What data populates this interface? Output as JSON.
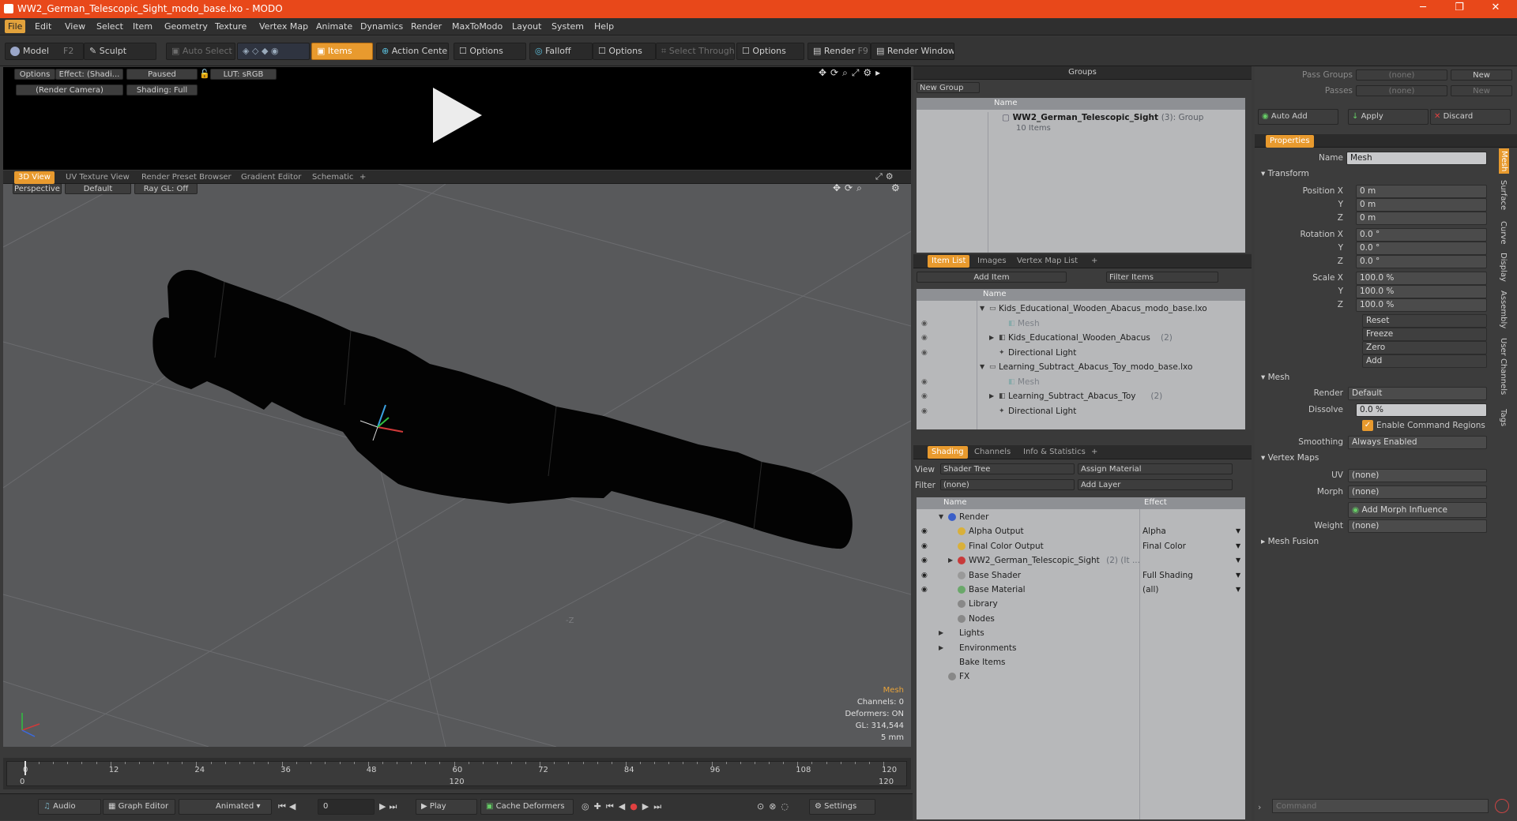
{
  "window": {
    "title": "WW2_German_Telescopic_Sight_modo_base.lxo - MODO",
    "min": "─",
    "max": "❐",
    "close": "✕"
  },
  "menu": [
    "File",
    "Edit",
    "View",
    "Select",
    "Item",
    "Geometry",
    "Texture",
    "Vertex Map",
    "Animate",
    "Dynamics",
    "Render",
    "MaxToModo",
    "Layout",
    "System",
    "Help"
  ],
  "toolbar": {
    "model": "Model",
    "model_key": "F2",
    "sculpt": "Sculpt",
    "auto_select": "Auto Select",
    "items": "Items",
    "action_center": "Action Center",
    "options1": "Options",
    "falloff": "Falloff",
    "options2": "Options",
    "select_through": "Select Through",
    "options3": "Options",
    "render": "Render",
    "render_key": "F9",
    "render_window": "Render Window"
  },
  "preview": {
    "options": "Options",
    "effect": "Effect: (Shadi...",
    "paused": "Paused",
    "lut": "LUT: sRGB",
    "camera": "(Render Camera)",
    "shading": "Shading: Full"
  },
  "viewtabs": [
    "3D View",
    "UV Texture View",
    "Render Preset Browser",
    "Gradient Editor",
    "Schematic",
    "+"
  ],
  "viewport": {
    "perspective": "Perspective",
    "default": "Default",
    "raygl": "Ray GL: Off",
    "hud_title": "Mesh",
    "hud_lines": [
      "Channels: 0",
      "Deformers: ON",
      "GL: 314,544",
      "5 mm"
    ],
    "axis_label": "-Z"
  },
  "timeline": {
    "ticks": [
      "0",
      "12",
      "24",
      "36",
      "48",
      "60",
      "72",
      "84",
      "96",
      "108",
      "120"
    ],
    "bottom_ticks": [
      "0",
      "120",
      "120"
    ]
  },
  "bottombar": {
    "audio": "Audio",
    "graph_editor": "Graph Editor",
    "animated": "Animated",
    "frame": "0",
    "play": "Play",
    "cache": "Cache Deformers",
    "settings": "Settings"
  },
  "groups": {
    "title": "Groups",
    "new_group": "New Group",
    "col_name": "Name",
    "item_name": "WW2_German_Telescopic_Sight",
    "item_count": "(3)",
    "item_type": ": Group",
    "item_sub": "10 Items"
  },
  "itemlist": {
    "tabs": [
      "Item List",
      "Images",
      "Vertex Map List",
      "+"
    ],
    "add_item": "Add Item",
    "filter": "Filter Items",
    "col_name": "Name",
    "rows": [
      {
        "t": "Kids_Educational_Wooden_Abacus_modo_base.lxo",
        "ind": 0,
        "dim": false,
        "exp": "▼",
        "eye": false
      },
      {
        "t": "Mesh",
        "ind": 2,
        "dim": true,
        "exp": "",
        "eye": true
      },
      {
        "t": "Kids_Educational_Wooden_Abacus",
        "extra": "(2)",
        "ind": 1,
        "dim": false,
        "exp": "▶",
        "eye": true
      },
      {
        "t": "Directional Light",
        "ind": 1,
        "dim": false,
        "exp": "",
        "eye": true
      },
      {
        "t": "Learning_Subtract_Abacus_Toy_modo_base.lxo",
        "ind": 0,
        "dim": false,
        "exp": "▼",
        "eye": false
      },
      {
        "t": "Mesh",
        "ind": 2,
        "dim": true,
        "exp": "",
        "eye": true
      },
      {
        "t": "Learning_Subtract_Abacus_Toy",
        "extra": "(2)",
        "ind": 1,
        "dim": false,
        "exp": "▶",
        "eye": true
      },
      {
        "t": "Directional Light",
        "ind": 1,
        "dim": false,
        "exp": "",
        "eye": true
      }
    ]
  },
  "shading": {
    "tabs": [
      "Shading",
      "Channels",
      "Info & Statistics",
      "+"
    ],
    "view_label": "View",
    "view_val": "Shader Tree",
    "assign": "Assign Material",
    "filter_label": "Filter",
    "filter_val": "(none)",
    "add_layer": "Add Layer",
    "col_name": "Name",
    "col_effect": "Effect",
    "rows": [
      {
        "t": "Render",
        "effect": "",
        "ind": 0,
        "exp": "▼",
        "eye": false,
        "icon": "#3b5fc8"
      },
      {
        "t": "Alpha Output",
        "effect": "Alpha",
        "ind": 1,
        "exp": "",
        "eye": true,
        "icon": "#d9b03a"
      },
      {
        "t": "Final Color Output",
        "effect": "Final Color",
        "ind": 1,
        "exp": "",
        "eye": true,
        "icon": "#d9b03a"
      },
      {
        "t": "WW2_German_Telescopic_Sight",
        "extra": "(2) (It ...",
        "effect": "",
        "ind": 1,
        "exp": "▶",
        "eye": true,
        "icon": "#c83a3a"
      },
      {
        "t": "Base Shader",
        "effect": "Full Shading",
        "ind": 1,
        "exp": "",
        "eye": true,
        "icon": "#999999"
      },
      {
        "t": "Base Material",
        "effect": "(all)",
        "ind": 1,
        "exp": "",
        "eye": true,
        "icon": "#6aa86a"
      },
      {
        "t": "Library",
        "effect": "",
        "ind": 1,
        "exp": "",
        "eye": false,
        "icon": "#888888"
      },
      {
        "t": "Nodes",
        "effect": "",
        "ind": 1,
        "exp": "",
        "eye": false,
        "icon": "#888888"
      },
      {
        "t": "Lights",
        "effect": "",
        "ind": 0,
        "exp": "▶",
        "eye": false,
        "icon": ""
      },
      {
        "t": "Environments",
        "effect": "",
        "ind": 0,
        "exp": "▶",
        "eye": false,
        "icon": ""
      },
      {
        "t": "Bake Items",
        "effect": "",
        "ind": 0,
        "exp": "",
        "eye": false,
        "icon": ""
      },
      {
        "t": "FX",
        "effect": "",
        "ind": 0,
        "exp": "",
        "eye": false,
        "icon": "#888888"
      }
    ]
  },
  "passes": {
    "pass_groups": "Pass Groups",
    "passes": "Passes",
    "none1": "(none)",
    "none2": "(none)",
    "new1": "New",
    "new2": "New",
    "auto_add": "Auto Add",
    "apply": "Apply",
    "discard": "Discard"
  },
  "properties": {
    "title": "Properties",
    "name_label": "Name",
    "name_val": "Mesh",
    "transform": "Transform",
    "pos_label": "Position X",
    "rot_label": "Rotation X",
    "scale_label": "Scale X",
    "y": "Y",
    "z": "Z",
    "pos": [
      "0 m",
      "0 m",
      "0 m"
    ],
    "rot": [
      "0.0 °",
      "0.0 °",
      "0.0 °"
    ],
    "scale": [
      "100.0 %",
      "100.0 %",
      "100.0 %"
    ],
    "reset": "Reset",
    "freeze": "Freeze",
    "zero": "Zero",
    "add": "Add",
    "mesh": "Mesh",
    "render_label": "Render",
    "render_val": "Default",
    "dissolve_label": "Dissolve",
    "dissolve_val": "0.0 %",
    "enable_cmd": "Enable Command Regions",
    "smoothing_label": "Smoothing",
    "smoothing_val": "Always Enabled",
    "vertex_maps": "Vertex Maps",
    "uv_label": "UV",
    "uv_val": "(none)",
    "morph_label": "Morph",
    "morph_val": "(none)",
    "add_morph": "Add Morph Influence",
    "weight_label": "Weight",
    "weight_val": "(none)",
    "mesh_fusion": "Mesh Fusion",
    "side_tabs": [
      "Mesh",
      "Surface",
      "Curve",
      "Display",
      "Assembly",
      "User Channels",
      "Tags"
    ]
  },
  "command": {
    "placeholder": "Command"
  },
  "colors": {
    "accent": "#e89a2e",
    "title": "#e8481a"
  }
}
